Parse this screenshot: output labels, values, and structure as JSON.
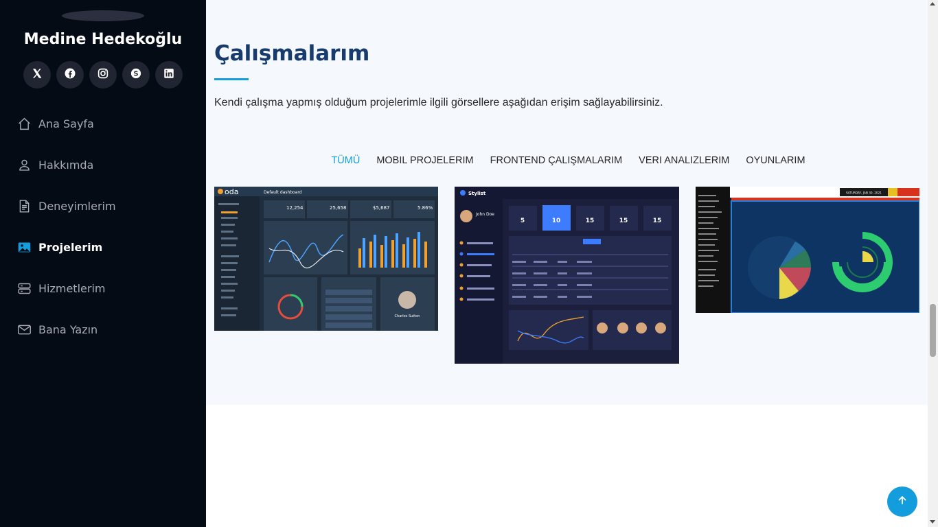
{
  "sidebar": {
    "profile_name": "Medine Hedekoğlu",
    "social": [
      {
        "icon": "x-twitter-icon"
      },
      {
        "icon": "facebook-icon"
      },
      {
        "icon": "instagram-icon"
      },
      {
        "icon": "skype-icon"
      },
      {
        "icon": "linkedin-icon"
      }
    ],
    "nav": [
      {
        "label": "Ana Sayfa",
        "icon": "house-icon",
        "active": false
      },
      {
        "label": "Hakkımda",
        "icon": "person-icon",
        "active": false
      },
      {
        "label": "Deneyimlerim",
        "icon": "file-text-icon",
        "active": false
      },
      {
        "label": "Projelerim",
        "icon": "images-icon",
        "active": true
      },
      {
        "label": "Hizmetlerim",
        "icon": "server-icon",
        "active": false
      },
      {
        "label": "Bana Yazın",
        "icon": "envelope-icon",
        "active": false
      }
    ]
  },
  "portfolio": {
    "title": "Çalışmalarım",
    "description": "Kendi çalışma yapmış olduğum projelerimle ilgili görsellere aşağıdan erişim sağlayabilirsiniz.",
    "filters": [
      {
        "label": "TÜMÜ",
        "active": true
      },
      {
        "label": "MOBIL PROJELERIM",
        "active": false
      },
      {
        "label": "FRONTEND ÇALIŞMALARIM",
        "active": false
      },
      {
        "label": "VERI ANALIZLERIM",
        "active": false
      },
      {
        "label": "OYUNLARIM",
        "active": false
      }
    ],
    "items": [
      {
        "name": "admin-dashboard-screenshot",
        "header": "Default dashboard",
        "logo": "oda",
        "stats": [
          "12,254",
          "25,658",
          "$5,687",
          "5.86%"
        ],
        "user": "Charles Sutton"
      },
      {
        "name": "stylist-dashboard-screenshot",
        "brand": "Stylist",
        "user": "John Doe",
        "stats": [
          "5",
          "10",
          "15",
          "15",
          "15"
        ]
      },
      {
        "name": "data-analytics-dashboard-screenshot",
        "date": "SATURDAY, JAN 30, 2021"
      }
    ]
  },
  "colors": {
    "sidebar_bg": "#040b14",
    "accent": "#149ddd",
    "main_bg": "#f5f8fd",
    "title": "#173b6c"
  },
  "back_to_top": {
    "icon": "arrow-up-icon"
  }
}
